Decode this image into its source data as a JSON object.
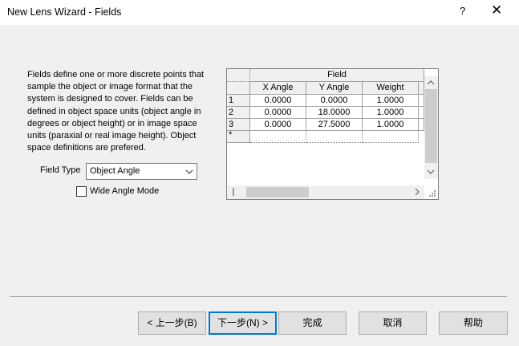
{
  "window": {
    "title": "New Lens Wizard - Fields",
    "help_label": "?",
    "close_label": "✕"
  },
  "description": "Fields define one or more discrete points that\nsample the object or image format that the\nsystem is designed to cover. Fields can be\ndefined in object space units (object angle in\ndegrees or object height) or in image space\nunits (paraxial or real image height). Object\nspace definitions are prefered.",
  "field_type": {
    "label": "Field Type",
    "value": "Object Angle"
  },
  "wide_angle": {
    "label": "Wide Angle Mode",
    "checked": false
  },
  "grid": {
    "group_header": "Field",
    "columns": [
      "X Angle",
      "Y Angle",
      "Weight"
    ],
    "rows": [
      {
        "id": "1",
        "cells": [
          "0.0000",
          "0.0000",
          "1.0000"
        ]
      },
      {
        "id": "2",
        "cells": [
          "0.0000",
          "18.0000",
          "1.0000"
        ]
      },
      {
        "id": "3",
        "cells": [
          "0.0000",
          "27.5000",
          "1.0000"
        ]
      }
    ],
    "new_row_marker": "*"
  },
  "buttons": {
    "back": "< 上一步(B)",
    "next": "下一步(N) >",
    "finish": "完成",
    "cancel": "取消",
    "help": "帮助"
  }
}
